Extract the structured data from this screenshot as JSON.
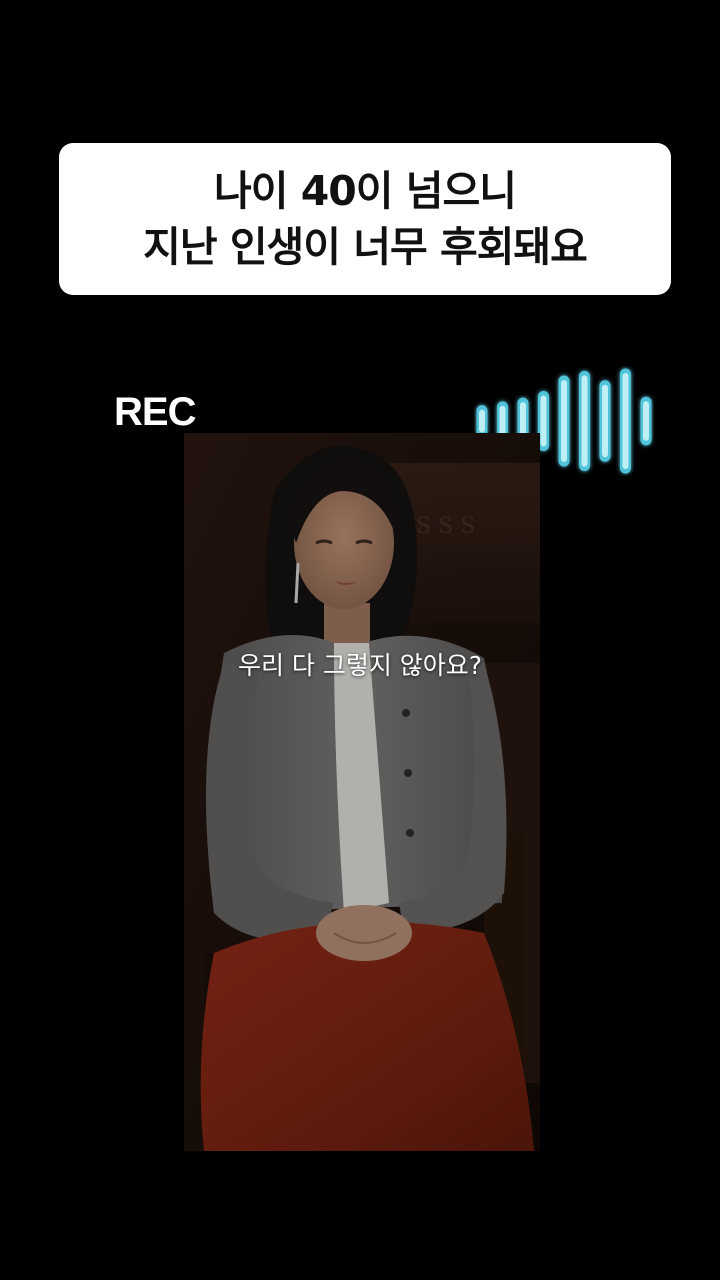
{
  "title_card": {
    "line1": "나이 40이 넘으니",
    "line2": "지난 인생이 너무 후회돼요"
  },
  "rec": {
    "label": "REC"
  },
  "waveform": {
    "icon": "audio-waveform-icon",
    "color": "#bfeff5",
    "glow_color": "#4fc3d9",
    "bar_levels": [
      0.22,
      0.3,
      0.38,
      0.52,
      0.85,
      0.95,
      0.75,
      1.0,
      0.4
    ]
  },
  "video": {
    "caption": "우리 다 그렇지 않아요?",
    "background_color": "#000000"
  }
}
